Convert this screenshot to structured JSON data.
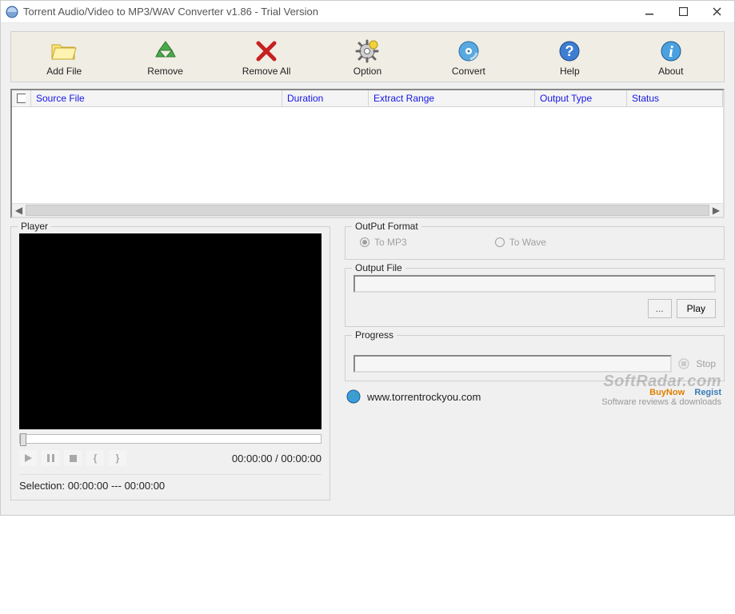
{
  "titlebar": {
    "title": "Torrent Audio/Video to MP3/WAV Converter v1.86 - Trial Version"
  },
  "toolbar": {
    "add_file": "Add File",
    "remove": "Remove",
    "remove_all": "Remove All",
    "option": "Option",
    "convert": "Convert",
    "help": "Help",
    "about": "About"
  },
  "grid": {
    "cols": {
      "source_file": "Source File",
      "duration": "Duration",
      "extract_range": "Extract Range",
      "output_type": "Output Type",
      "status": "Status"
    }
  },
  "player": {
    "legend": "Player",
    "time_current": "00:00:00",
    "time_total": "00:00:00",
    "selection_label": "Selection:",
    "selection_start": "00:00:00",
    "selection_end": "00:00:00"
  },
  "output_format": {
    "legend": "OutPut Format",
    "to_mp3": "To MP3",
    "to_wave": "To Wave"
  },
  "output_file": {
    "legend": "Output File",
    "browse": "...",
    "play": "Play",
    "value": ""
  },
  "progress": {
    "legend": "Progress",
    "stop": "Stop"
  },
  "footer": {
    "url": "www.torrentrockyou.com",
    "watermark_main": "SoftRadar.com",
    "watermark_sub": "Software reviews & downloads",
    "buynow": "BuyNow",
    "regist": "Regist"
  }
}
